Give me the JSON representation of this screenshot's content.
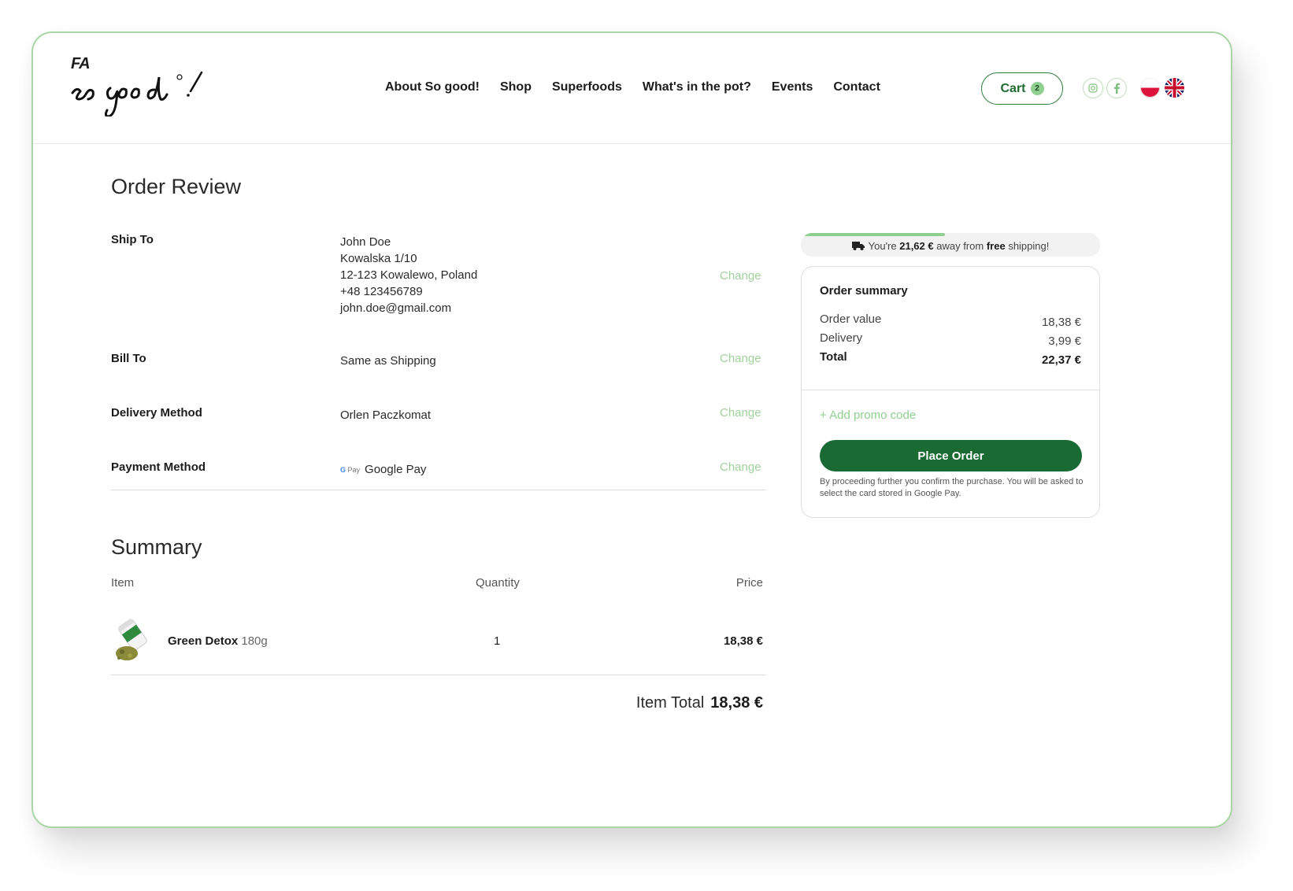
{
  "brand": {
    "logo_top": "FA",
    "logo_script": "so good"
  },
  "nav": {
    "items": [
      "About So good!",
      "Shop",
      "Superfoods",
      "What's in the pot?",
      "Events",
      "Contact"
    ]
  },
  "header": {
    "cart_label": "Cart",
    "cart_count": "2",
    "social": [
      "instagram-icon",
      "facebook-icon"
    ],
    "languages": [
      "polish-flag",
      "uk-flag"
    ]
  },
  "order": {
    "title": "Order Review",
    "ship_to_label": "Ship To",
    "ship_to": [
      "John Doe",
      "Kowalska 1/10",
      "12-123 Kowalewo, Poland",
      "+48 123456789",
      "john.doe@gmail.com"
    ],
    "bill_to_label": "Bill To",
    "bill_to": "Same as Shipping",
    "delivery_label": "Delivery Method",
    "delivery": "Orlen Paczkomat",
    "payment_label": "Payment Method",
    "payment": "Google Pay",
    "payment_badge": "Pay",
    "payment_badge_g": "G",
    "change_label": "Change"
  },
  "summary": {
    "title": "Summary",
    "col_item": "Item",
    "col_qty": "Quantity",
    "col_price": "Price",
    "items": [
      {
        "name": "Green Detox",
        "size": "180g",
        "qty": "1",
        "price": "18,38 €"
      }
    ],
    "item_total_label": "Item Total",
    "item_total": "18,38 €"
  },
  "shipping_notice": {
    "prefix": "You're",
    "amount": "21,62 €",
    "middle": "away from",
    "free": "free",
    "suffix": "shipping!",
    "progress": 0.47
  },
  "order_summary": {
    "title": "Order summary",
    "order_value_label": "Order value",
    "order_value": "18,38 €",
    "delivery_label": "Delivery",
    "delivery": "3,99 €",
    "total_label": "Total",
    "total": "22,37 €",
    "promo": "+ Add promo code",
    "place_order": "Place Order",
    "fine_print": "By proceeding further you confirm the purchase. You will be asked to select the card stored in Google Pay."
  },
  "colors": {
    "accent": "#1a6a33",
    "accent_light": "#8fcf8f",
    "frame_border": "#a8d5a3"
  }
}
